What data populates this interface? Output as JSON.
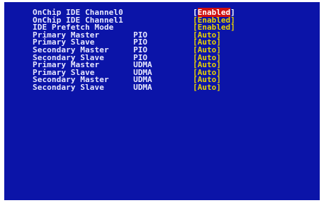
{
  "settings": [
    {
      "name": "OnChip IDE Channel0",
      "mode": "",
      "value": "Enabled",
      "selected": true
    },
    {
      "name": "OnChip IDE Channel1",
      "mode": "",
      "value": "Enabled",
      "selected": false
    },
    {
      "name": "IDE Prefetch Mode",
      "mode": "",
      "value": "Enabled",
      "selected": false
    },
    {
      "name": "Primary Master",
      "mode": "PIO",
      "value": "Auto",
      "selected": false
    },
    {
      "name": "Primary Slave",
      "mode": "PIO",
      "value": "Auto",
      "selected": false
    },
    {
      "name": "Secondary Master",
      "mode": "PIO",
      "value": "Auto",
      "selected": false
    },
    {
      "name": "Secondary Slave",
      "mode": "PIO",
      "value": "Auto",
      "selected": false
    },
    {
      "name": "Primary Master",
      "mode": "UDMA",
      "value": "Auto",
      "selected": false
    },
    {
      "name": "Primary Slave",
      "mode": "UDMA",
      "value": "Auto",
      "selected": false
    },
    {
      "name": "Secondary Master",
      "mode": "UDMA",
      "value": "Auto",
      "selected": false
    },
    {
      "name": "Secondary Slave",
      "mode": "UDMA",
      "value": "Auto",
      "selected": false
    }
  ],
  "colors": {
    "background": "#0b14a8",
    "label_text": "#e8e8ff",
    "value_text": "#e8d200",
    "selection_highlight": "#d01010"
  }
}
